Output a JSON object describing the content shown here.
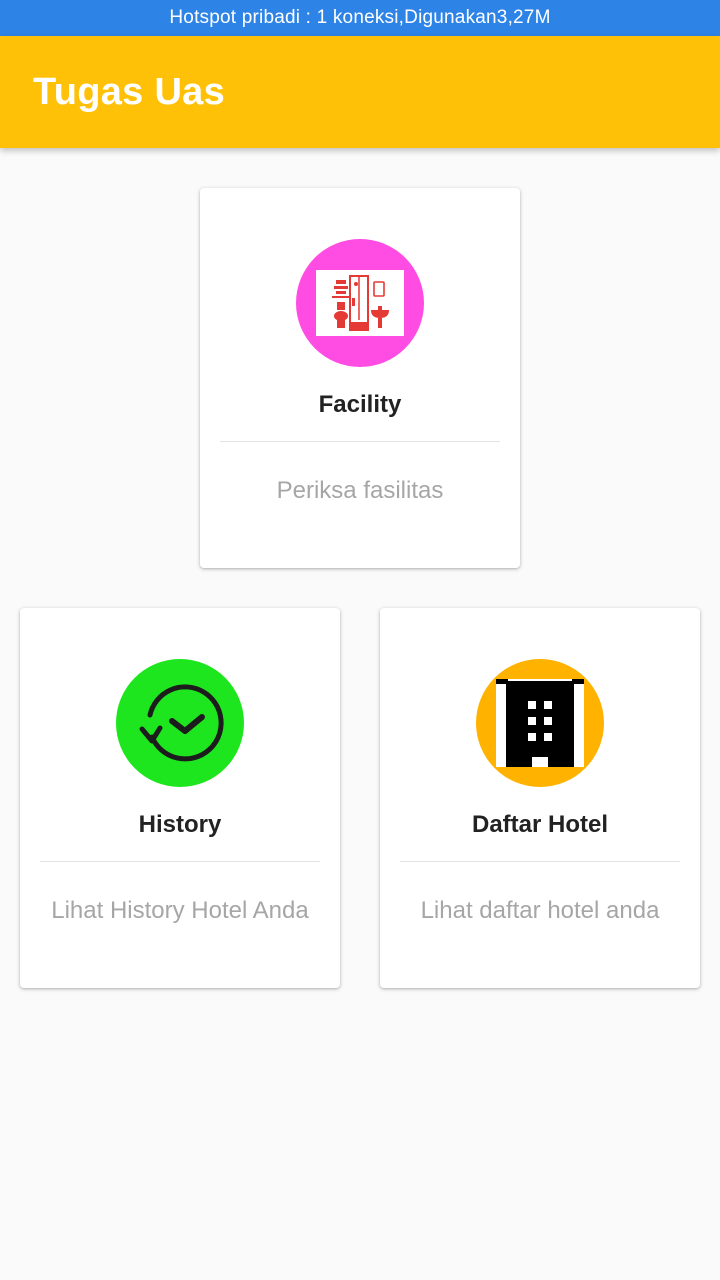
{
  "status_bar": {
    "text": "Hotspot pribadi : 1 koneksi,Digunakan3,27M"
  },
  "app_bar": {
    "title": "Tugas Uas",
    "color": "#ffc107"
  },
  "cards": [
    {
      "title": "Facility",
      "description": "Periksa fasilitas",
      "icon": "bathroom-facility-icon",
      "circle_color": "#ff4de3"
    },
    {
      "title": "History",
      "description": "Lihat History Hotel Anda",
      "icon": "history-clock-icon",
      "circle_color": "#1ee61e"
    },
    {
      "title": "Daftar Hotel",
      "description": "Lihat daftar hotel anda",
      "icon": "hotel-building-icon",
      "circle_color": "#ffb300"
    }
  ]
}
